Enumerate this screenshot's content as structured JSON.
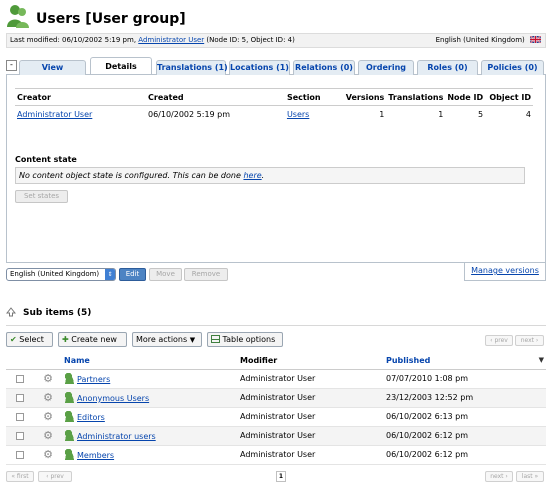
{
  "header": {
    "title": "Users [User group]",
    "meta_prefix": "Last modified: 06/10/2002 5:19 pm,",
    "meta_user": "Administrator User",
    "meta_suffix": "(Node ID: 5, Object ID: 4)",
    "language": "English (United Kingdom)"
  },
  "tabs": {
    "collapse": "-",
    "items": [
      {
        "label": "View"
      },
      {
        "label": "Details"
      },
      {
        "label": "Translations (1)"
      },
      {
        "label": "Locations (1)"
      },
      {
        "label": "Relations (0)"
      },
      {
        "label": "Ordering"
      },
      {
        "label": "Roles (0)"
      },
      {
        "label": "Policies (0)"
      }
    ]
  },
  "details": {
    "columns": [
      "Creator",
      "Created",
      "Section",
      "Versions",
      "Translations",
      "Node ID",
      "Object ID"
    ],
    "row": {
      "creator": "Administrator User",
      "created": "06/10/2002 5:19 pm",
      "section": "Users",
      "versions": "1",
      "translations": "1",
      "node_id": "5",
      "object_id": "4"
    },
    "content_state": {
      "title": "Content state",
      "message": "No content object state is configured. This can be done",
      "link": "here",
      "suffix": ".",
      "button": "Set states"
    }
  },
  "panel_bar": {
    "language": "English (United Kingdom)",
    "edit": "Edit",
    "move": "Move",
    "remove": "Remove",
    "manage_versions": "Manage versions"
  },
  "sub_items": {
    "title": "Sub items (5)",
    "toolbar": {
      "select": "Select",
      "create_new": "Create new",
      "more_actions": "More actions",
      "table_options": "Table options",
      "prev": "‹ prev",
      "next": "next ›"
    },
    "columns": [
      "Name",
      "Modifier",
      "Published"
    ],
    "rows": [
      {
        "name": "Partners",
        "modifier": "Administrator User",
        "published": "07/07/2010 1:08 pm"
      },
      {
        "name": "Anonymous Users",
        "modifier": "Administrator User",
        "published": "23/12/2003 12:52 pm"
      },
      {
        "name": "Editors",
        "modifier": "Administrator User",
        "published": "06/10/2002 6:13 pm"
      },
      {
        "name": "Administrator users",
        "modifier": "Administrator User",
        "published": "06/10/2002 6:12 pm"
      },
      {
        "name": "Members",
        "modifier": "Administrator User",
        "published": "06/10/2002 6:12 pm"
      }
    ],
    "pager": {
      "first": "« first",
      "prev": "‹ prev",
      "current": "1",
      "next": "next ›",
      "last": "last »"
    }
  },
  "colors": {
    "link": "#0645ad",
    "tab_bg": "#e4ecf3",
    "border": "#b8c2cc",
    "button_blue": "#4c83c3"
  }
}
